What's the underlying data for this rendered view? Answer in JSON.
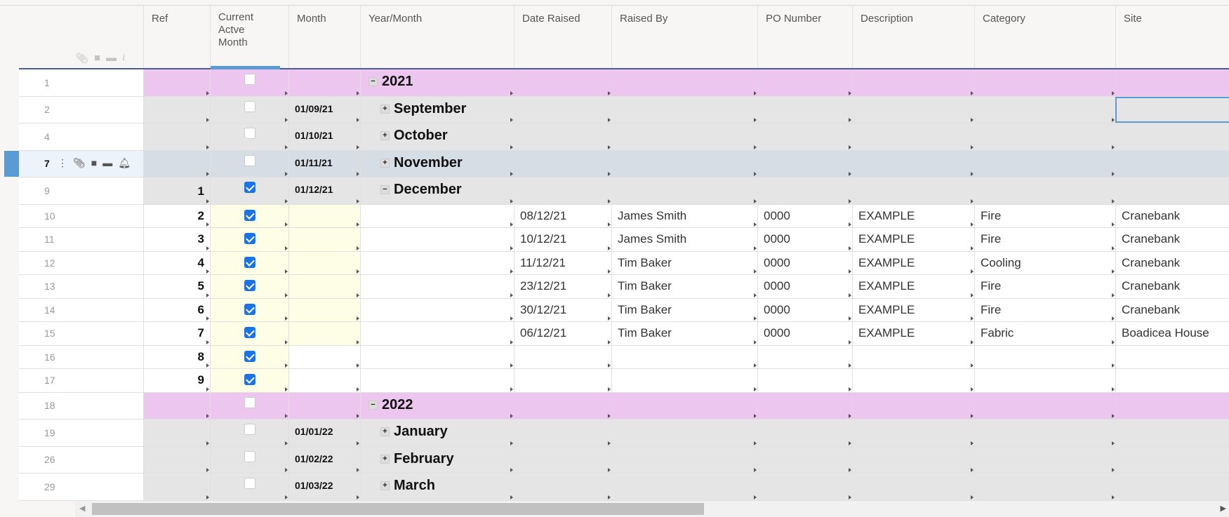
{
  "columns": [
    "Ref",
    "Current Actve Month",
    "Month",
    "Year/Month",
    "Date Raised",
    "Raised By",
    "PO Number",
    "Description",
    "Category",
    "Site"
  ],
  "rows": [
    {
      "n": "1",
      "type": "year",
      "cb": false,
      "month": "",
      "label": "2021",
      "toggle": "−"
    },
    {
      "n": "2",
      "type": "month",
      "cb": false,
      "month": "01/09/21",
      "label": "September",
      "toggle": "+"
    },
    {
      "n": "4",
      "type": "month",
      "cb": false,
      "month": "01/10/21",
      "label": "October",
      "toggle": "+"
    },
    {
      "n": "7",
      "type": "sel",
      "cb": false,
      "month": "01/11/21",
      "label": "November",
      "toggle": "+"
    },
    {
      "n": "9",
      "type": "month",
      "ref": "1",
      "cb": true,
      "month": "01/12/21",
      "label": "December",
      "toggle": "−"
    },
    {
      "n": "10",
      "type": "data",
      "ref": "2",
      "cb": true,
      "yellow": true,
      "cells": [
        "08/12/21",
        "James Smith",
        "0000",
        "EXAMPLE",
        "Fire",
        "Cranebank"
      ]
    },
    {
      "n": "11",
      "type": "data",
      "ref": "3",
      "cb": true,
      "yellow": true,
      "cells": [
        "10/12/21",
        "James Smith",
        "0000",
        "EXAMPLE",
        "Fire",
        "Cranebank"
      ]
    },
    {
      "n": "12",
      "type": "data",
      "ref": "4",
      "cb": true,
      "yellow": true,
      "cells": [
        "11/12/21",
        "Tim Baker",
        "0000",
        "EXAMPLE",
        "Cooling",
        "Cranebank"
      ]
    },
    {
      "n": "13",
      "type": "data",
      "ref": "5",
      "cb": true,
      "yellow": true,
      "cells": [
        "23/12/21",
        "Tim Baker",
        "0000",
        "EXAMPLE",
        "Fire",
        "Cranebank"
      ]
    },
    {
      "n": "14",
      "type": "data",
      "ref": "6",
      "cb": true,
      "yellow": true,
      "cells": [
        "30/12/21",
        "Tim Baker",
        "0000",
        "EXAMPLE",
        "Fire",
        "Cranebank"
      ]
    },
    {
      "n": "15",
      "type": "data",
      "ref": "7",
      "cb": true,
      "yellow": true,
      "cells": [
        "06/12/21",
        "Tim Baker",
        "0000",
        "EXAMPLE",
        "Fabric",
        "Boadicea House"
      ]
    },
    {
      "n": "16",
      "type": "data",
      "ref": "8",
      "cb": true,
      "yellow": false,
      "cells": [
        "",
        "",
        "",
        "",
        "",
        ""
      ]
    },
    {
      "n": "17",
      "type": "data",
      "ref": "9",
      "cb": true,
      "yellow": false,
      "cells": [
        "",
        "",
        "",
        "",
        "",
        ""
      ]
    },
    {
      "n": "18",
      "type": "year",
      "cb": false,
      "month": "",
      "label": "2022",
      "toggle": "−"
    },
    {
      "n": "19",
      "type": "month",
      "cb": false,
      "month": "01/01/22",
      "label": "January",
      "toggle": "+"
    },
    {
      "n": "26",
      "type": "month",
      "cb": false,
      "month": "01/02/22",
      "label": "February",
      "toggle": "+"
    },
    {
      "n": "29",
      "type": "month",
      "cb": false,
      "month": "01/03/22",
      "label": "March",
      "toggle": "+"
    }
  ],
  "colors": {
    "year": "#ecc6ee",
    "month": "#e5e5e5",
    "sel": "#d6dde5",
    "yellow": "#fefee6",
    "accent": "#5b9bd5"
  }
}
